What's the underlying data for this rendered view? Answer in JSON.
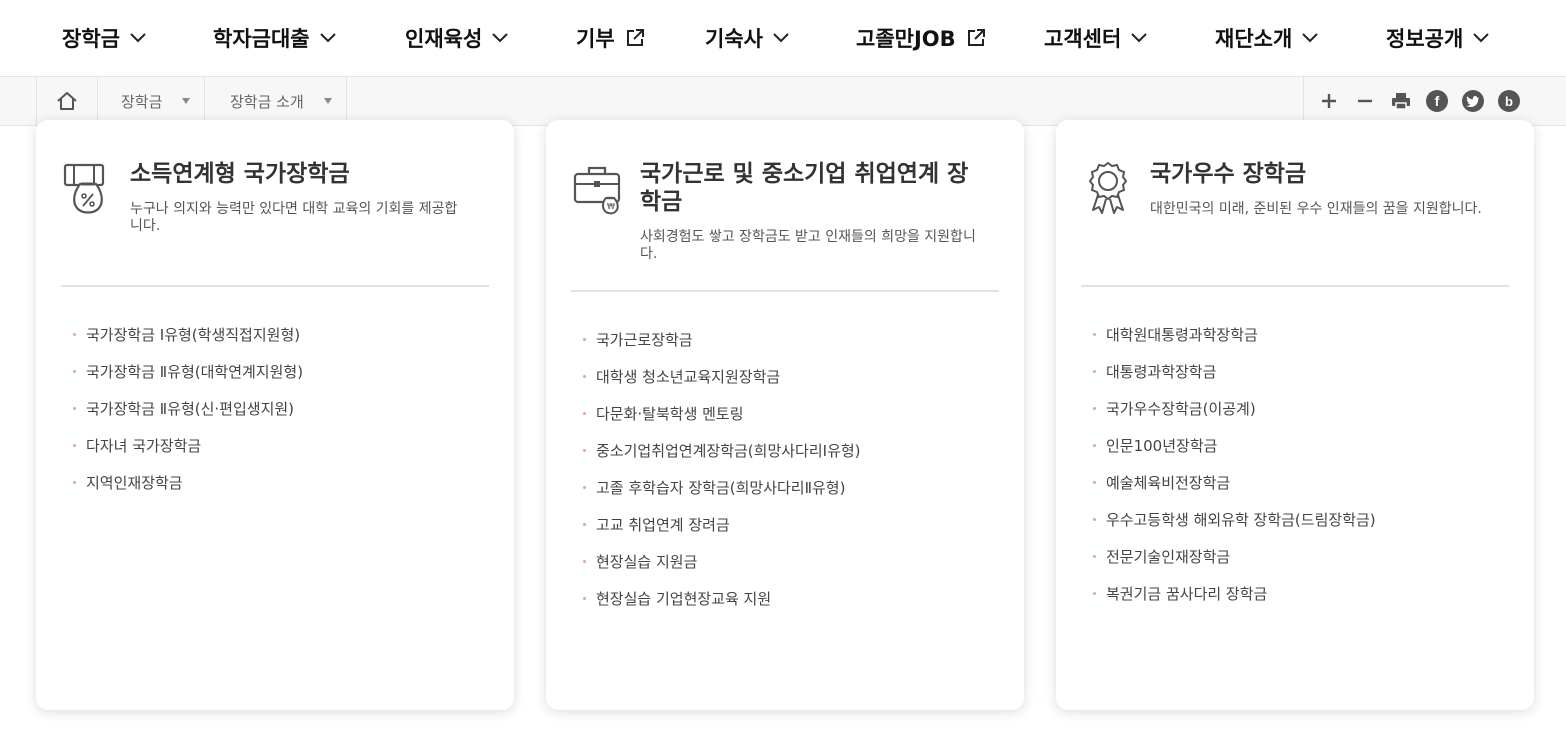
{
  "gnb": {
    "items": [
      {
        "label": "장학금",
        "icon": "chevron-down-icon"
      },
      {
        "label": "학자금대출",
        "icon": "chevron-down-icon"
      },
      {
        "label": "인재육성",
        "icon": "chevron-down-icon"
      },
      {
        "label": "기부",
        "icon": "external-link-icon"
      },
      {
        "label": "기숙사",
        "icon": "chevron-down-icon"
      },
      {
        "label": "고졸만JOB",
        "icon": "external-link-icon"
      },
      {
        "label": "고객센터",
        "icon": "chevron-down-icon"
      },
      {
        "label": "재단소개",
        "icon": "chevron-down-icon"
      },
      {
        "label": "정보공개",
        "icon": "chevron-down-icon"
      }
    ]
  },
  "location": {
    "home_icon": "home-icon",
    "crumbs": [
      {
        "label": "장학금"
      },
      {
        "label": "장학금 소개"
      }
    ],
    "tools": [
      "zoom-in-icon",
      "zoom-out-icon",
      "print-icon",
      "facebook-icon",
      "twitter-icon",
      "blog-icon"
    ]
  },
  "cards": [
    {
      "icon": "money-bag-percent-icon",
      "title": "소득연계형 국가장학금",
      "desc": "누구나 의지와 능력만 있다면 대학 교육의 기회를 제공합니다.",
      "items": [
        "국가장학금 Ⅰ유형(학생직접지원형)",
        "국가장학금 Ⅱ유형(대학연계지원형)",
        "국가장학금 Ⅱ유형(신·편입생지원)",
        "다자녀 국가장학금",
        "지역인재장학금"
      ]
    },
    {
      "icon": "briefcase-money-icon",
      "title": "국가근로 및 중소기업 취업연계 장학금",
      "desc": "사회경험도 쌓고 장학금도 받고 인재들의 희망을 지원합니다.",
      "items": [
        "국가근로장학금",
        "대학생 청소년교육지원장학금",
        "다문화·탈북학생 멘토링",
        "중소기업취업연계장학금(희망사다리Ⅰ유형)",
        "고졸 후학습자 장학금(희망사다리Ⅱ유형)",
        "고교 취업연계 장려금",
        "현장실습 지원금",
        "현장실습 기업현장교육 지원"
      ]
    },
    {
      "icon": "award-medal-icon",
      "title": "국가우수 장학금",
      "desc": "대한민국의 미래, 준비된 우수 인재들의 꿈을 지원합니다.",
      "items": [
        "대학원대통령과학장학금",
        "대통령과학장학금",
        "국가우수장학금(이공계)",
        "인문100년장학금",
        "예술체육비전장학금",
        "우수고등학생 해외유학 장학금(드림장학금)",
        "전문기술인재장학금",
        "복권기금 꿈사다리 장학금"
      ]
    }
  ]
}
